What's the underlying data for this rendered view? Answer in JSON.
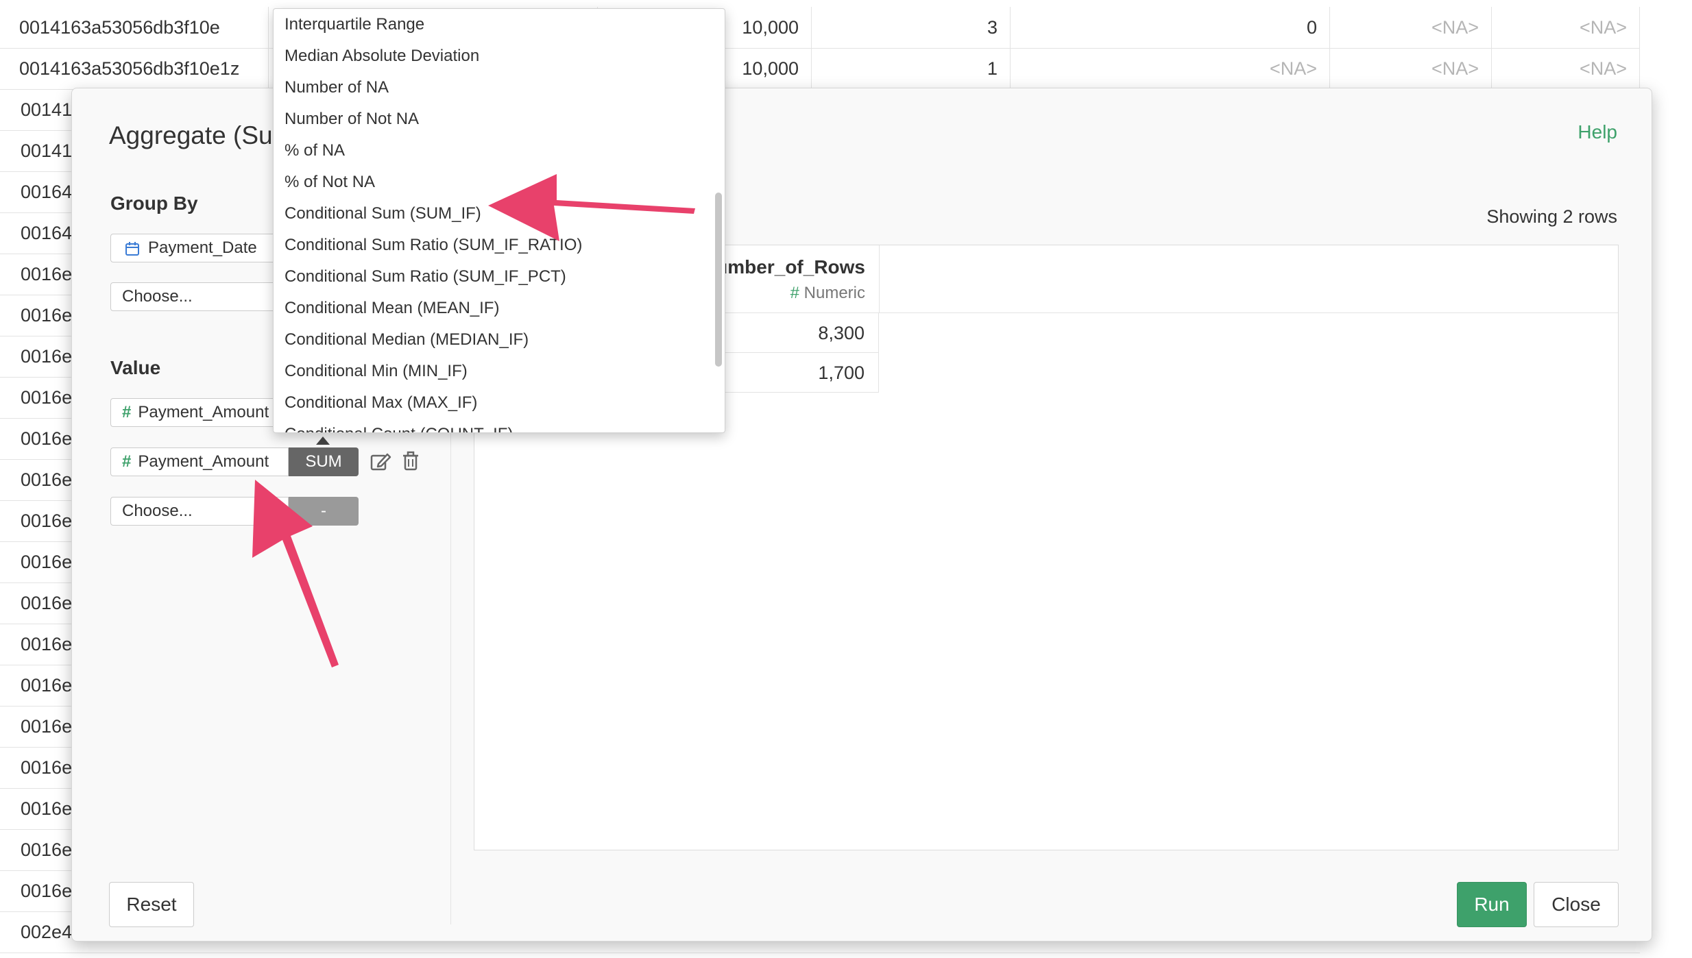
{
  "background": {
    "rows": [
      {
        "id": "0014163a53056db3f10e",
        "amount": "10,000",
        "count": "3",
        "c4": "0",
        "c5": "<NA>",
        "c6": "<NA>"
      },
      {
        "id": "0014163a53056db3f10e1z",
        "amount": "10,000",
        "count": "1",
        "c4": "<NA>",
        "c5": "<NA>",
        "c6": "<NA>"
      }
    ],
    "id_fragments": [
      "00141",
      "00141",
      "00164",
      "00164",
      "0016e",
      "0016e",
      "0016e",
      "0016e",
      "0016e",
      "0016e",
      "0016e",
      "0016e",
      "0016e",
      "0016e",
      "0016e",
      "0016e",
      "0016e",
      "0016e",
      "0016e",
      "0016e",
      "002e4"
    ]
  },
  "dialog": {
    "title": "Aggregate (Sur",
    "help_label": "Help",
    "group_by": {
      "label": "Group By",
      "fields": [
        {
          "name": "Payment_Date",
          "icon": "calendar-icon"
        }
      ],
      "choose_placeholder": "Choose..."
    },
    "value": {
      "label": "Value",
      "fields": [
        {
          "name": "Payment_Amount",
          "icon": "numeric-hash-icon"
        },
        {
          "name": "Payment_Amount",
          "icon": "numeric-hash-icon",
          "agg": "SUM"
        }
      ],
      "choose_placeholder": "Choose...",
      "empty_agg": "-"
    },
    "preview": {
      "showing_text": "Showing 2 rows",
      "column": {
        "name": "umber_of_Rows",
        "type": "Numeric"
      },
      "values": [
        "8,300",
        "1,700"
      ]
    },
    "buttons": {
      "reset": "Reset",
      "run": "Run",
      "close": "Close"
    }
  },
  "dropdown": {
    "items": [
      "Interquartile Range",
      "Median Absolute Deviation",
      "Number of NA",
      "Number of Not NA",
      "% of NA",
      "% of Not NA",
      "Conditional Sum (SUM_IF)",
      "Conditional Sum Ratio (SUM_IF_RATIO)",
      "Conditional Sum Ratio (SUM_IF_PCT)",
      "Conditional Mean (MEAN_IF)",
      "Conditional Median (MEDIAN_IF)",
      "Conditional Min (MIN_IF)",
      "Conditional Max (MAX_IF)",
      "Conditional Count (COUNT_IF)"
    ]
  },
  "colors": {
    "accent_green": "#3ea16b",
    "annotation_pink": "#e8416b",
    "agg_button": "#666666",
    "agg_button_empty": "#9a9a9a"
  }
}
